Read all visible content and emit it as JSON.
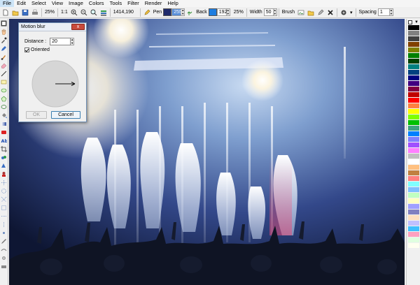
{
  "menu": [
    "File",
    "Edit",
    "Select",
    "View",
    "Image",
    "Colors",
    "Tools",
    "Filter",
    "Render",
    "Help"
  ],
  "toolbar": {
    "zoom_label": "25%",
    "ratio_label": "1:1",
    "coords_label": "1414,190",
    "pen_label": "Pen",
    "pen_value": "255",
    "pen_color": "#1f2a6b",
    "back_label": "Back",
    "back_value": "192",
    "back_color": "#1e7de0",
    "opacity_value": "25%",
    "width_label": "Width",
    "width_value": "50",
    "brush_label": "Brush",
    "spacing_label": "Spacing",
    "spacing_value": "1"
  },
  "dialog": {
    "title": "Motion blur",
    "close_label": "x",
    "distance_label": "Distance :",
    "distance_value": "20",
    "oriented_label": "Oriented",
    "oriented_checked": true,
    "ok_label": "OK",
    "cancel_label": "Cancel"
  },
  "palette": {
    "colors": [
      "#000000",
      "#808080",
      "#404040",
      "#804000",
      "#808000",
      "#008000",
      "#004000",
      "#008080",
      "#004080",
      "#000080",
      "#400080",
      "#800040",
      "#c00000",
      "#ff0000",
      "#ff8040",
      "#ffff00",
      "#80ff00",
      "#00c000",
      "#40a080",
      "#0080ff",
      "#8080ff",
      "#a050ff",
      "#ff80ff",
      "#c0c0c0",
      "#ffffff",
      "#ffc080",
      "#c08040",
      "#ff8080",
      "#80ffff",
      "#80c0ff",
      "#c0ffc0",
      "#ffffc0",
      "#a0a0ff",
      "#8080c0",
      "#ffe0c0",
      "#c0c0ff",
      "#40c0ff",
      "#ffa0c0",
      "#e0ffe0",
      "#fffff0"
    ]
  }
}
